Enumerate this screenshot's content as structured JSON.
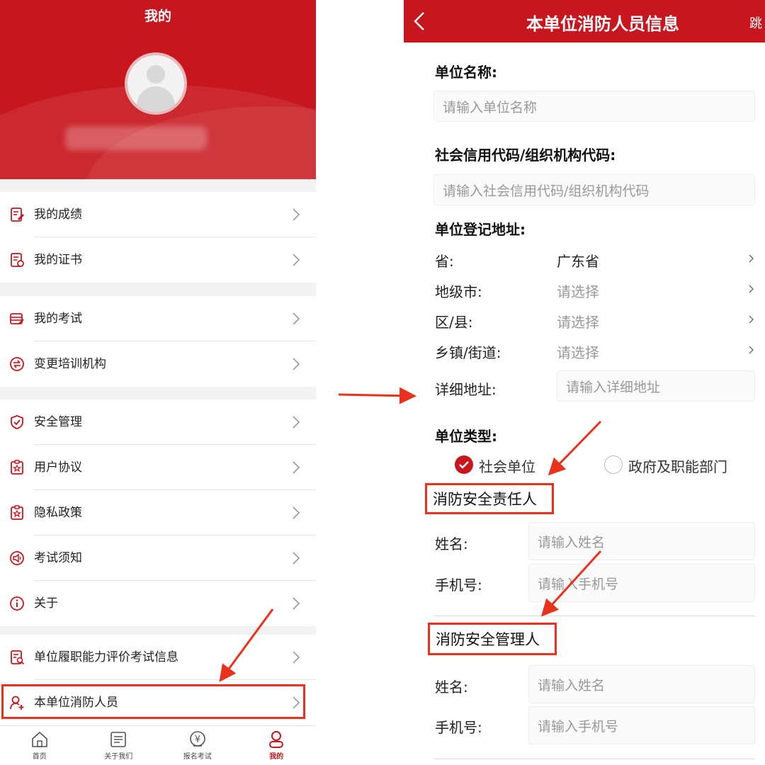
{
  "left": {
    "profile": {
      "title": "我的"
    },
    "menu_groups": [
      [
        {
          "label": "我的成绩",
          "icon": "score-icon"
        },
        {
          "label": "我的证书",
          "icon": "certificate-icon"
        }
      ],
      [
        {
          "label": "我的考试",
          "icon": "exam-icon"
        },
        {
          "label": "变更培训机构",
          "icon": "switch-icon"
        }
      ],
      [
        {
          "label": "安全管理",
          "icon": "shield-icon"
        },
        {
          "label": "用户协议",
          "icon": "agreement-icon"
        },
        {
          "label": "隐私政策",
          "icon": "privacy-icon"
        },
        {
          "label": "考试须知",
          "icon": "notice-icon"
        },
        {
          "label": "关于",
          "icon": "info-icon"
        }
      ],
      [
        {
          "label": "单位履职能力评价考试信息",
          "icon": "evaluation-icon"
        },
        {
          "label": "本单位消防人员",
          "icon": "add-person-icon"
        }
      ]
    ],
    "tabbar": [
      {
        "label": "首页",
        "icon": "home-icon"
      },
      {
        "label": "关于我们",
        "icon": "about-icon"
      },
      {
        "label": "报名考试",
        "icon": "yen-icon"
      },
      {
        "label": "我的",
        "icon": "person-icon",
        "active": true
      }
    ]
  },
  "right": {
    "nav": {
      "title": "本单位消防人员信息",
      "skip": "跳"
    },
    "unit_name": {
      "label": "单位名称:",
      "placeholder": "请输入单位名称"
    },
    "credit_code": {
      "label": "社会信用代码/组织机构代码:",
      "placeholder": "请输入社会信用代码/组织机构代码"
    },
    "address": {
      "label": "单位登记地址:",
      "province": {
        "label": "省:",
        "value": "广东省"
      },
      "city": {
        "label": "地级市:",
        "value": "请选择"
      },
      "district": {
        "label": "区/县:",
        "value": "请选择"
      },
      "town": {
        "label": "乡镇/街道:",
        "value": "请选择"
      },
      "detail": {
        "label": "详细地址:",
        "placeholder": "请输入详细地址"
      }
    },
    "unit_type": {
      "label": "单位类型:",
      "options": [
        {
          "label": "社会单位",
          "selected": true
        },
        {
          "label": "政府及职能部门",
          "selected": false
        }
      ]
    },
    "responsible_person": {
      "title": "消防安全责任人",
      "name": {
        "label": "姓名:",
        "placeholder": "请输入姓名"
      },
      "phone": {
        "label": "手机号:",
        "placeholder": "请输入手机号"
      }
    },
    "manager_person": {
      "title": "消防安全管理人",
      "name": {
        "label": "姓名:",
        "placeholder": "请输入姓名"
      },
      "phone": {
        "label": "手机号:",
        "placeholder": "请输入手机号"
      }
    }
  },
  "colors": {
    "brand_red": "#c8161e",
    "annotation_red": "#e8321c",
    "placeholder": "#999999"
  }
}
